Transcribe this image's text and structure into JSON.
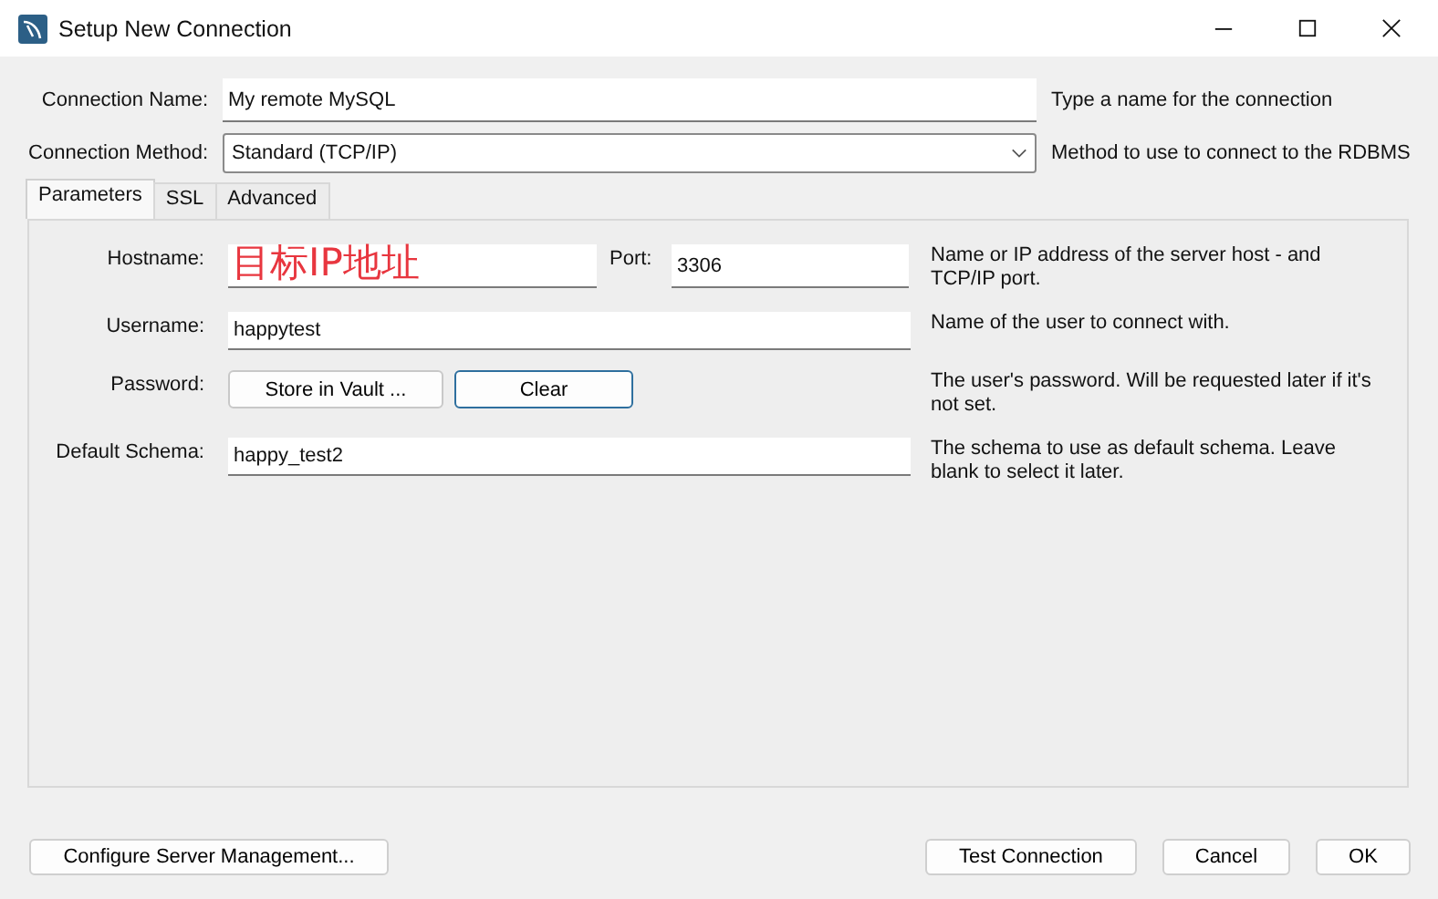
{
  "window": {
    "title": "Setup New Connection"
  },
  "connection_name": {
    "label": "Connection Name:",
    "value": "My remote MySQL",
    "help": "Type a name for the connection"
  },
  "connection_method": {
    "label": "Connection Method:",
    "value": "Standard (TCP/IP)",
    "help": "Method to use to connect to the RDBMS"
  },
  "tabs": [
    {
      "label": "Parameters",
      "selected": true
    },
    {
      "label": "SSL",
      "selected": false
    },
    {
      "label": "Advanced",
      "selected": false
    }
  ],
  "hostname": {
    "label": "Hostname:",
    "annotation": "目标IP地址",
    "port_label": "Port:",
    "port": "3306",
    "help": "Name or IP address of the server host - and TCP/IP port."
  },
  "username": {
    "label": "Username:",
    "value": "happytest",
    "help": "Name of the user to connect with."
  },
  "password": {
    "label": "Password:",
    "buttons": [
      {
        "label": "Store in Vault ...",
        "focused": false
      },
      {
        "label": "Clear",
        "focused": true
      }
    ],
    "help": "The user's password. Will be requested later if it's not set."
  },
  "default_schema": {
    "label": "Default Schema:",
    "value": "happy_test2",
    "help": "The schema to use as default schema. Leave blank to select it later."
  },
  "footer": {
    "left": "Configure Server Management...",
    "right": [
      "Test Connection",
      "Cancel",
      "OK"
    ]
  }
}
